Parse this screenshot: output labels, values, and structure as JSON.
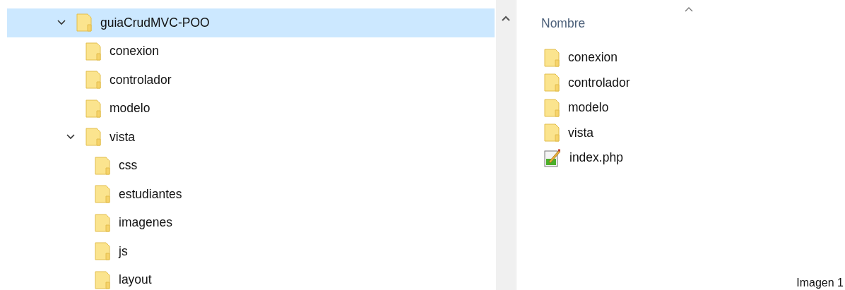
{
  "tree": [
    {
      "label": "guiaCrudMVC-POO",
      "selected": true,
      "expanded": true,
      "children": [
        {
          "label": "conexion",
          "selected": false
        },
        {
          "label": "controlador",
          "selected": false
        },
        {
          "label": "modelo",
          "selected": false
        },
        {
          "label": "vista",
          "selected": false,
          "expanded": true,
          "children": [
            {
              "label": "css",
              "selected": false
            },
            {
              "label": "estudiantes",
              "selected": false
            },
            {
              "label": "imagenes",
              "selected": false
            },
            {
              "label": "js",
              "selected": false
            },
            {
              "label": "layout",
              "selected": false
            }
          ]
        }
      ]
    }
  ],
  "file_list": {
    "column_header": "Nombre",
    "items": [
      {
        "name": "conexion",
        "kind": "folder"
      },
      {
        "name": "controlador",
        "kind": "folder"
      },
      {
        "name": "modelo",
        "kind": "folder"
      },
      {
        "name": "vista",
        "kind": "folder"
      },
      {
        "name": "index.php",
        "kind": "file"
      }
    ]
  },
  "caption": "Imagen 1"
}
